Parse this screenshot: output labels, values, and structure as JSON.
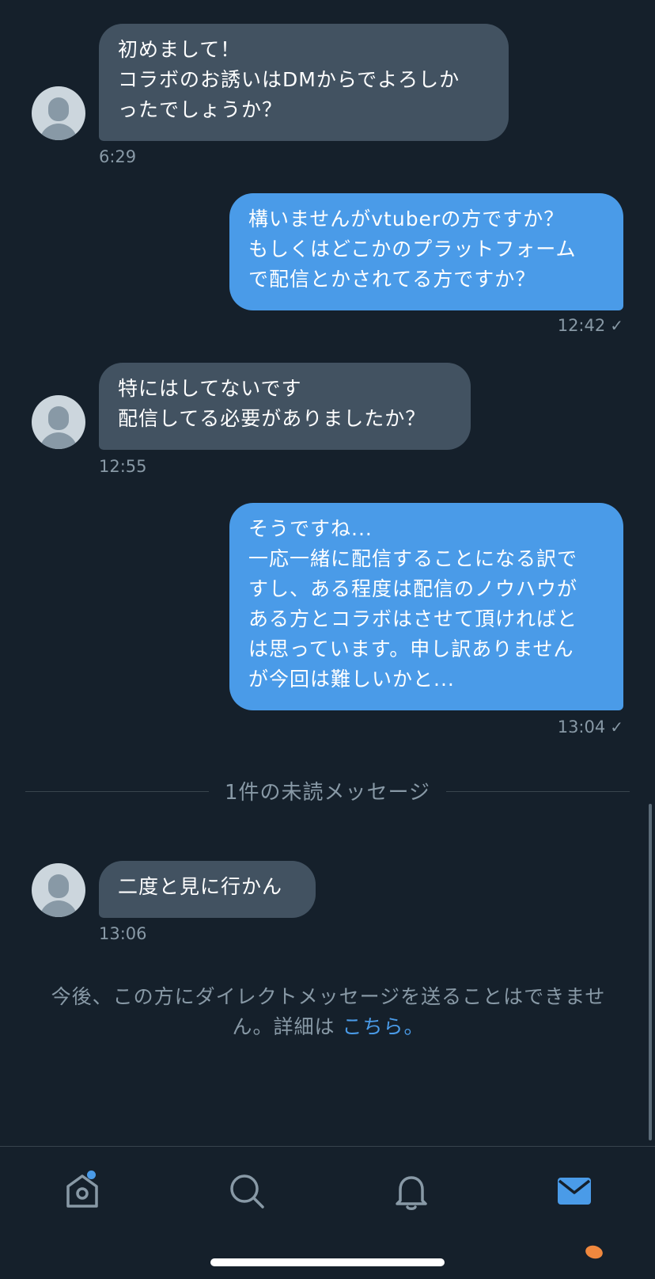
{
  "messages": [
    {
      "direction": "in",
      "text": "初めまして！\nコラボのお誘いはDMからでよろしか\nったでしょうか？",
      "time": "6:29"
    },
    {
      "direction": "out",
      "text": "構いませんがvtuberの方ですか？\nもしくはどこかのプラットフォーム\nで配信とかされてる方ですか？",
      "time": "12:42"
    },
    {
      "direction": "in",
      "text": "特にはしてないです\n配信してる必要がありましたか？",
      "time": "12:55"
    },
    {
      "direction": "out",
      "text": "そうですね...\n一応一緒に配信することになる訳で\nすし、ある程度は配信のノウハウが\nある方とコラボはさせて頂ければと\nは思っています。申し訳ありません\nが今回は難しいかと...",
      "time": "13:04"
    },
    {
      "direction": "in",
      "text": "二度と見に行かん",
      "time": "13:06"
    }
  ],
  "read_mark": "✓",
  "unread_divider": "1件の未読メッセージ",
  "notice": {
    "text": "今後、この方にダイレクトメッセージを送ることはできませ\nん。詳細は ",
    "link": "こちら。"
  },
  "tabs": [
    {
      "name": "home",
      "icon": "home-icon",
      "has_badge": true
    },
    {
      "name": "search",
      "icon": "search-icon",
      "has_badge": false
    },
    {
      "name": "notifications",
      "icon": "bell-icon",
      "has_badge": false
    },
    {
      "name": "messages",
      "icon": "mail-icon",
      "active": true
    }
  ],
  "colors": {
    "background": "#15202b",
    "incoming_bubble": "#425261",
    "outgoing_bubble": "#4a9be8",
    "accent": "#4a9be8",
    "muted": "#8899a6"
  }
}
